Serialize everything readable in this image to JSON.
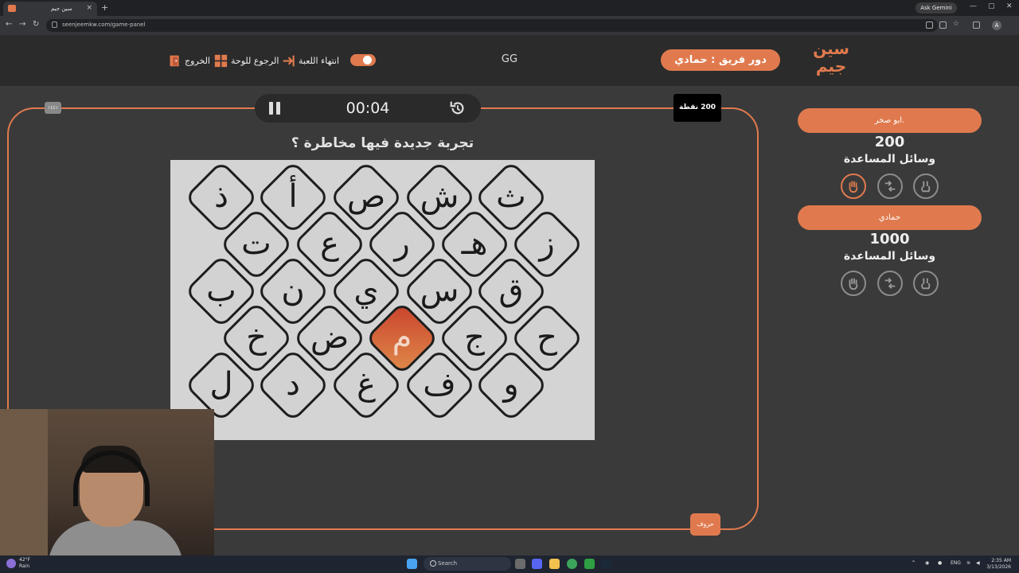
{
  "browser": {
    "tab_title": "سين جيم",
    "tab_close": "×",
    "new_tab": "+",
    "url": "seenjeemkw.com/game-panel",
    "ask_gemini": "Ask Gemini",
    "profile_initial": "A",
    "window_controls": [
      "—",
      "▢",
      "✕"
    ]
  },
  "header": {
    "logo_text": "سين جيم",
    "turn_label": "دور فريق : حمادي",
    "game_name": "GG",
    "end_game_label": "انتهاء اللعبة",
    "back_to_board_label": "الرجوع للوحة",
    "exit_label": "الخروج",
    "accent_color": "#e07a4e"
  },
  "timer": {
    "time": "00:04"
  },
  "small_tag": "١٤٤١",
  "points_badge": "200 نقطة",
  "letters_tag": "حروف",
  "question": "تجربة جديدة فيها مخاطرة ؟",
  "board": {
    "letters": [
      "ث",
      "ش",
      "ص",
      "أ",
      "ذ",
      "ز",
      "هـ",
      "ر",
      "ع",
      "ت",
      "ق",
      "س",
      "ي",
      "ن",
      "ب",
      "ح",
      "ج",
      "م",
      "ض",
      "خ",
      "و",
      "ف",
      "غ",
      "د",
      "ل"
    ],
    "active_letter": "م"
  },
  "teams": [
    {
      "name": ".ابو صخر",
      "score": "200",
      "help_label": "وسائل المساعدة"
    },
    {
      "name": "حمادي",
      "score": "1000",
      "help_label": "وسائل المساعدة"
    }
  ],
  "taskbar": {
    "temperature": "42°F",
    "weather": "Rain",
    "search_placeholder": "Search",
    "language": "ENG",
    "time": "2:35 AM",
    "date": "3/13/2026"
  }
}
